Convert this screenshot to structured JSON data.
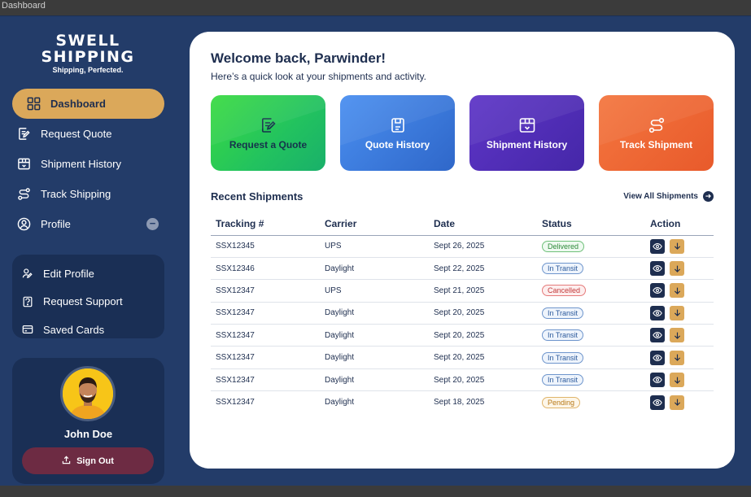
{
  "window": {
    "title": "Dashboard"
  },
  "brand": {
    "line1": "SWELL",
    "line2": "SHIPPING",
    "tagline": "Shipping, Perfected."
  },
  "sidebar": {
    "items": [
      {
        "label": "Dashboard",
        "icon": "dashboard-grid-icon",
        "active": true
      },
      {
        "label": "Request Quote",
        "icon": "edit-note-icon"
      },
      {
        "label": "Shipment History",
        "icon": "package-box-icon"
      },
      {
        "label": "Track Shipping",
        "icon": "route-icon"
      },
      {
        "label": "Profile",
        "icon": "user-circle-icon",
        "expanded": true,
        "toggle": "−"
      }
    ],
    "submenu": [
      {
        "label": "Edit Profile",
        "icon": "user-edit-icon"
      },
      {
        "label": "Request Support",
        "icon": "support-doc-icon"
      },
      {
        "label": "Saved Cards",
        "icon": "credit-card-icon"
      }
    ]
  },
  "user": {
    "name": "John Doe",
    "signout_label": "Sign Out"
  },
  "main": {
    "welcome": "Welcome back, Parwinder!",
    "subtitle": "Here’s a quick look at your shipments and activity.",
    "tiles": [
      {
        "label": "Request a Quote",
        "icon": "edit-note-icon",
        "color": "#3adb41"
      },
      {
        "label": "Quote History",
        "icon": "receipt-box-icon",
        "color": "#3f7fe0"
      },
      {
        "label": "Shipment History",
        "icon": "package-box-icon",
        "color": "#5230b8"
      },
      {
        "label": "Track Shipment",
        "icon": "route-icon",
        "color": "#ee6834"
      }
    ],
    "recent_title": "Recent Shipments",
    "view_all": "View All Shipments"
  },
  "table": {
    "headers": [
      "Tracking #",
      "Carrier",
      "Date",
      "Status",
      "Action"
    ],
    "rows": [
      {
        "tracking": "SSX12345",
        "carrier": "UPS",
        "date": "Sept 26, 2025",
        "status": "Delivered",
        "status_kind": "delivered"
      },
      {
        "tracking": "SSX12346",
        "carrier": "Daylight",
        "date": "Sept 22, 2025",
        "status": "In Transit",
        "status_kind": "transit"
      },
      {
        "tracking": "SSX12347",
        "carrier": "UPS",
        "date": "Sept 21, 2025",
        "status": "Cancelled",
        "status_kind": "cancelled"
      },
      {
        "tracking": "SSX12347",
        "carrier": "Daylight",
        "date": "Sept 20, 2025",
        "status": "In Transit",
        "status_kind": "transit"
      },
      {
        "tracking": "SSX12347",
        "carrier": "Daylight",
        "date": "Sept 20, 2025",
        "status": "In Transit",
        "status_kind": "transit"
      },
      {
        "tracking": "SSX12347",
        "carrier": "Daylight",
        "date": "Sept 20, 2025",
        "status": "In Transit",
        "status_kind": "transit"
      },
      {
        "tracking": "SSX12347",
        "carrier": "Daylight",
        "date": "Sept 20, 2025",
        "status": "In Transit",
        "status_kind": "transit"
      },
      {
        "tracking": "SSX12347",
        "carrier": "Daylight",
        "date": "Sept 18, 2025",
        "status": "Pending",
        "status_kind": "pending"
      }
    ]
  },
  "colors": {
    "sidebar_bg": "#233c69",
    "accent": "#dba85a",
    "text_dark": "#1e2e4f",
    "signout": "#6d2b43"
  }
}
